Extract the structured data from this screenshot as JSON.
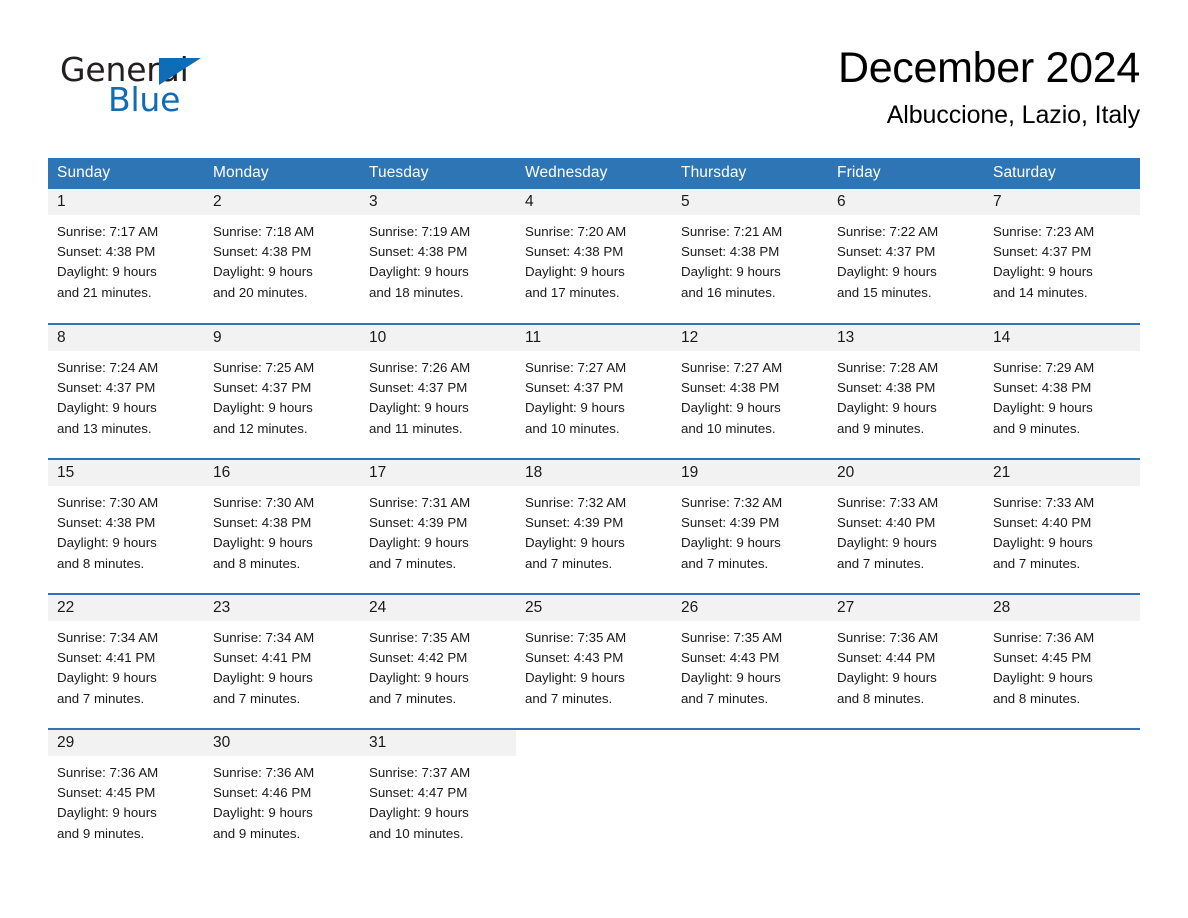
{
  "brand": {
    "name_top": "General",
    "name_bottom": "Blue",
    "triangle_color": "#0f6cb6",
    "top_color": "#231f20"
  },
  "header": {
    "month_title": "December 2024",
    "location": "Albuccione, Lazio, Italy"
  },
  "theme": {
    "header_blue": "#2e75b6",
    "daynum_band": "#f2f2f2",
    "row_divider": "#2e75b6",
    "text": "#1a1a1a"
  },
  "weekday_headers": [
    "Sunday",
    "Monday",
    "Tuesday",
    "Wednesday",
    "Thursday",
    "Friday",
    "Saturday"
  ],
  "weeks": [
    [
      {
        "day": "1",
        "info": "Sunrise: 7:17 AM\nSunset: 4:38 PM\nDaylight: 9 hours\nand 21 minutes."
      },
      {
        "day": "2",
        "info": "Sunrise: 7:18 AM\nSunset: 4:38 PM\nDaylight: 9 hours\nand 20 minutes."
      },
      {
        "day": "3",
        "info": "Sunrise: 7:19 AM\nSunset: 4:38 PM\nDaylight: 9 hours\nand 18 minutes."
      },
      {
        "day": "4",
        "info": "Sunrise: 7:20 AM\nSunset: 4:38 PM\nDaylight: 9 hours\nand 17 minutes."
      },
      {
        "day": "5",
        "info": "Sunrise: 7:21 AM\nSunset: 4:38 PM\nDaylight: 9 hours\nand 16 minutes."
      },
      {
        "day": "6",
        "info": "Sunrise: 7:22 AM\nSunset: 4:37 PM\nDaylight: 9 hours\nand 15 minutes."
      },
      {
        "day": "7",
        "info": "Sunrise: 7:23 AM\nSunset: 4:37 PM\nDaylight: 9 hours\nand 14 minutes."
      }
    ],
    [
      {
        "day": "8",
        "info": "Sunrise: 7:24 AM\nSunset: 4:37 PM\nDaylight: 9 hours\nand 13 minutes."
      },
      {
        "day": "9",
        "info": "Sunrise: 7:25 AM\nSunset: 4:37 PM\nDaylight: 9 hours\nand 12 minutes."
      },
      {
        "day": "10",
        "info": "Sunrise: 7:26 AM\nSunset: 4:37 PM\nDaylight: 9 hours\nand 11 minutes."
      },
      {
        "day": "11",
        "info": "Sunrise: 7:27 AM\nSunset: 4:37 PM\nDaylight: 9 hours\nand 10 minutes."
      },
      {
        "day": "12",
        "info": "Sunrise: 7:27 AM\nSunset: 4:38 PM\nDaylight: 9 hours\nand 10 minutes."
      },
      {
        "day": "13",
        "info": "Sunrise: 7:28 AM\nSunset: 4:38 PM\nDaylight: 9 hours\nand 9 minutes."
      },
      {
        "day": "14",
        "info": "Sunrise: 7:29 AM\nSunset: 4:38 PM\nDaylight: 9 hours\nand 9 minutes."
      }
    ],
    [
      {
        "day": "15",
        "info": "Sunrise: 7:30 AM\nSunset: 4:38 PM\nDaylight: 9 hours\nand 8 minutes."
      },
      {
        "day": "16",
        "info": "Sunrise: 7:30 AM\nSunset: 4:38 PM\nDaylight: 9 hours\nand 8 minutes."
      },
      {
        "day": "17",
        "info": "Sunrise: 7:31 AM\nSunset: 4:39 PM\nDaylight: 9 hours\nand 7 minutes."
      },
      {
        "day": "18",
        "info": "Sunrise: 7:32 AM\nSunset: 4:39 PM\nDaylight: 9 hours\nand 7 minutes."
      },
      {
        "day": "19",
        "info": "Sunrise: 7:32 AM\nSunset: 4:39 PM\nDaylight: 9 hours\nand 7 minutes."
      },
      {
        "day": "20",
        "info": "Sunrise: 7:33 AM\nSunset: 4:40 PM\nDaylight: 9 hours\nand 7 minutes."
      },
      {
        "day": "21",
        "info": "Sunrise: 7:33 AM\nSunset: 4:40 PM\nDaylight: 9 hours\nand 7 minutes."
      }
    ],
    [
      {
        "day": "22",
        "info": "Sunrise: 7:34 AM\nSunset: 4:41 PM\nDaylight: 9 hours\nand 7 minutes."
      },
      {
        "day": "23",
        "info": "Sunrise: 7:34 AM\nSunset: 4:41 PM\nDaylight: 9 hours\nand 7 minutes."
      },
      {
        "day": "24",
        "info": "Sunrise: 7:35 AM\nSunset: 4:42 PM\nDaylight: 9 hours\nand 7 minutes."
      },
      {
        "day": "25",
        "info": "Sunrise: 7:35 AM\nSunset: 4:43 PM\nDaylight: 9 hours\nand 7 minutes."
      },
      {
        "day": "26",
        "info": "Sunrise: 7:35 AM\nSunset: 4:43 PM\nDaylight: 9 hours\nand 7 minutes."
      },
      {
        "day": "27",
        "info": "Sunrise: 7:36 AM\nSunset: 4:44 PM\nDaylight: 9 hours\nand 8 minutes."
      },
      {
        "day": "28",
        "info": "Sunrise: 7:36 AM\nSunset: 4:45 PM\nDaylight: 9 hours\nand 8 minutes."
      }
    ],
    [
      {
        "day": "29",
        "info": "Sunrise: 7:36 AM\nSunset: 4:45 PM\nDaylight: 9 hours\nand 9 minutes."
      },
      {
        "day": "30",
        "info": "Sunrise: 7:36 AM\nSunset: 4:46 PM\nDaylight: 9 hours\nand 9 minutes."
      },
      {
        "day": "31",
        "info": "Sunrise: 7:37 AM\nSunset: 4:47 PM\nDaylight: 9 hours\nand 10 minutes."
      },
      {
        "day": "",
        "info": ""
      },
      {
        "day": "",
        "info": ""
      },
      {
        "day": "",
        "info": ""
      },
      {
        "day": "",
        "info": ""
      }
    ]
  ]
}
